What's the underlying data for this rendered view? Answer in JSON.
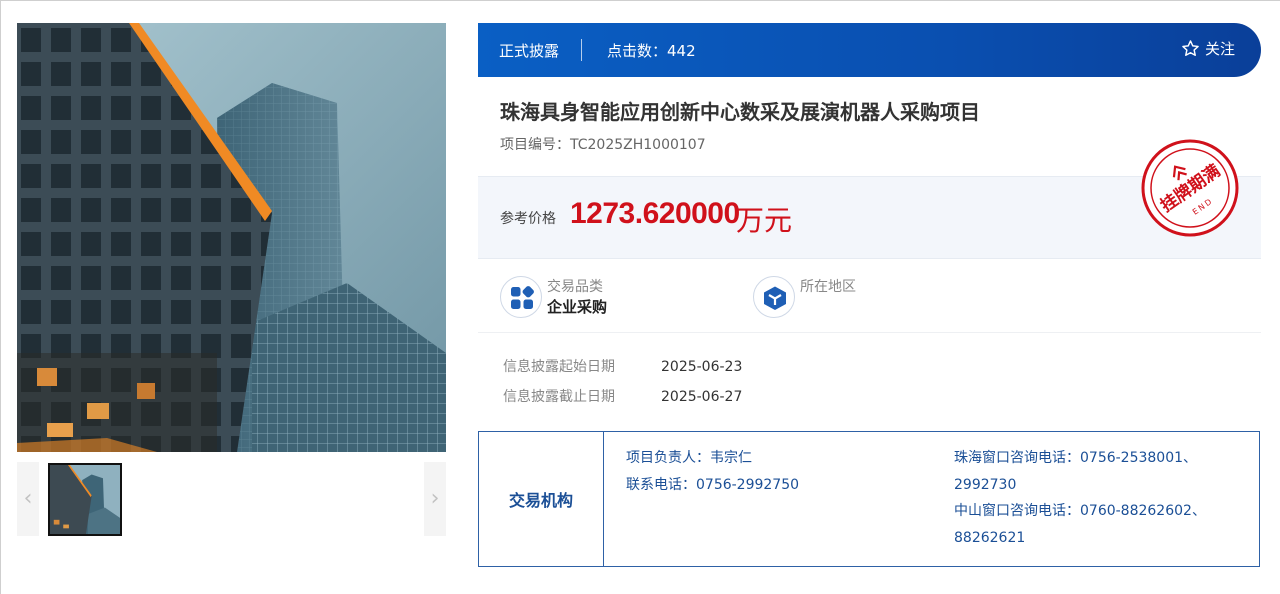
{
  "status": "正式披露",
  "clicks": "点击数：442",
  "follow_label": "关注",
  "project": {
    "title": "珠海具身智能应用创新中心数采及展演机器人采购项目",
    "code_label": "项目编号：",
    "code": "TC2025ZH1000107"
  },
  "stamp": {
    "text": "挂牌期满",
    "sub": "END",
    "color": "#d0111b"
  },
  "price": {
    "label": "参考价格",
    "value": "1273.620000",
    "unit": "万元"
  },
  "attributes": [
    {
      "label": "交易品类",
      "value": "企业采购",
      "icon": "grid-icon"
    },
    {
      "label": "所在地区",
      "value": "",
      "icon": "cube-icon"
    }
  ],
  "dates": [
    {
      "label": "信息披露起始日期",
      "value": "2025-06-23"
    },
    {
      "label": "信息披露截止日期",
      "value": "2025-06-27"
    }
  ],
  "institution": {
    "heading": "交易机构",
    "contact_person": "项目负责人：韦宗仁",
    "contact_phone": "联系电话：0756-2992750",
    "zhuhai_line1": "珠海窗口咨询电话：0756-2538001、",
    "zhuhai_line2": "2992730",
    "zhongshan_line1": "中山窗口咨询电话：0760-88262602、",
    "zhongshan_line2": "88262621"
  },
  "gallery": {
    "prev_glyph": "‹",
    "next_glyph": "›"
  },
  "colors": {
    "brand_blue": "#0a5fc4",
    "price_red": "#d0111b",
    "institution_blue": "#1b4f96"
  }
}
